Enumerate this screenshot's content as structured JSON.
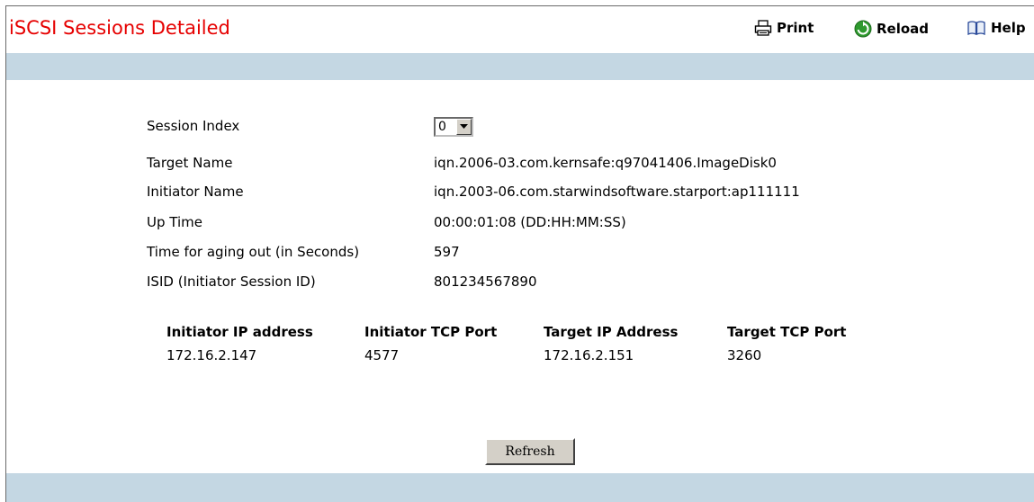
{
  "header": {
    "title": "iSCSI Sessions Detailed",
    "title_color": "#e60000",
    "toolbar": {
      "print_label": "Print",
      "reload_label": "Reload",
      "help_label": "Help"
    },
    "band_color": "#c4d7e3"
  },
  "session": {
    "index_label": "Session Index",
    "index_value": "0",
    "fields": [
      {
        "label": "Target Name",
        "value": "iqn.2006-03.com.kernsafe:q97041406.ImageDisk0"
      },
      {
        "label": "Initiator Name",
        "value": "iqn.2003-06.com.starwindsoftware.starport:ap111111"
      },
      {
        "label": "Up Time",
        "value": "00:00:01:08 (DD:HH:MM:SS)"
      },
      {
        "label": "Time for aging out (in Seconds)",
        "value": "597"
      },
      {
        "label": "ISID (Initiator Session ID)",
        "value": "801234567890"
      }
    ]
  },
  "connections": {
    "headers": [
      "Initiator IP address",
      "Initiator TCP Port",
      "Target IP Address",
      "Target TCP Port"
    ],
    "rows": [
      [
        "172.16.2.147",
        "4577",
        "172.16.2.151",
        "3260"
      ]
    ]
  },
  "actions": {
    "refresh_label": "Refresh"
  }
}
